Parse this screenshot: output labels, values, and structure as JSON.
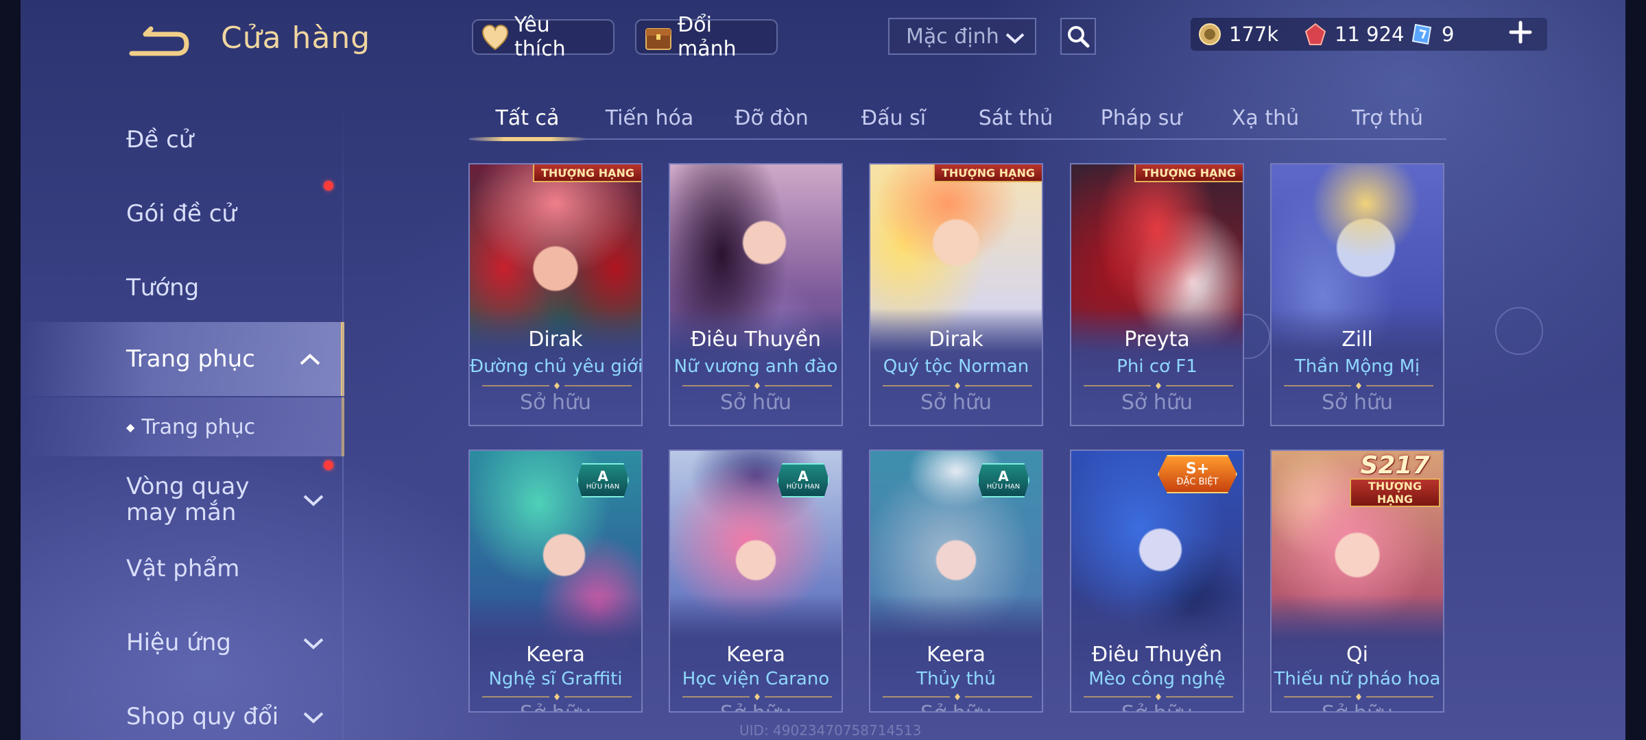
{
  "header": {
    "title": "Cửa hàng"
  },
  "sidebar": {
    "items": [
      {
        "label": "Đề cử"
      },
      {
        "label": "Gói đề cử"
      },
      {
        "label": "Tướng"
      },
      {
        "label": "Trang phục"
      },
      {
        "label": "Trang phục"
      },
      {
        "label": "Vòng quay may mắn"
      },
      {
        "label": "Vật phẩm"
      },
      {
        "label": "Hiệu ứng"
      },
      {
        "label": "Shop quy đổi"
      }
    ]
  },
  "toolbar": {
    "favorite_label": "Yêu thích",
    "exchange_label": "Đổi mảnh",
    "sort_value": "Mặc định"
  },
  "currency": {
    "gold": "177k",
    "vouchers": "11 924",
    "tickets": "9"
  },
  "tabs": [
    {
      "label": "Tất cả"
    },
    {
      "label": "Tiến hóa"
    },
    {
      "label": "Đỡ đòn"
    },
    {
      "label": "Đấu sĩ"
    },
    {
      "label": "Sát thủ"
    },
    {
      "label": "Pháp sư"
    },
    {
      "label": "Xạ thủ"
    },
    {
      "label": "Trợ thủ"
    }
  ],
  "cards": [
    {
      "hero": "Dirak",
      "skin": "Đường chủ yêu giới",
      "status": "Sở hữu",
      "badge": "THƯỢNG HẠNG"
    },
    {
      "hero": "Điêu Thuyền",
      "skin": "Nữ vương anh đào",
      "status": "Sở hữu",
      "badge": ""
    },
    {
      "hero": "Dirak",
      "skin": "Quý tộc Norman",
      "status": "Sở hữu",
      "badge": "THƯỢNG HẠNG"
    },
    {
      "hero": "Preyta",
      "skin": "Phi cơ F1",
      "status": "Sở hữu",
      "badge": "THƯỢNG HẠNG"
    },
    {
      "hero": "Zill",
      "skin": "Thần Mộng Mị",
      "status": "Sở hữu",
      "badge": ""
    },
    {
      "hero": "Keera",
      "skin": "Nghệ sĩ Graffiti",
      "status": "Sở hữu",
      "badge": "A",
      "badge_sub": "HỮU HẠN"
    },
    {
      "hero": "Keera",
      "skin": "Học viện Carano",
      "status": "Sở hữu",
      "badge": "A",
      "badge_sub": "HỮU HẠN"
    },
    {
      "hero": "Keera",
      "skin": "Thủy thủ",
      "status": "Sở hữu",
      "badge": "A",
      "badge_sub": "HỮU HẠN"
    },
    {
      "hero": "Điêu Thuyền",
      "skin": "Mèo công nghệ",
      "status": "Sở hữu",
      "badge": "S+",
      "badge_sub": "ĐẶC BIỆT"
    },
    {
      "hero": "Qi",
      "skin": "Thiếu nữ pháo hoa",
      "status": "Sở hữu",
      "badge": "S217",
      "badge_sub": "THƯỢNG HẠNG"
    }
  ],
  "footer": {
    "uid": "UID: 49023470758714513"
  },
  "colors": {
    "accent_gold": "#f1cf88",
    "skin_name_blue": "#8fd8ff",
    "notification_red": "#ff3b3b"
  }
}
